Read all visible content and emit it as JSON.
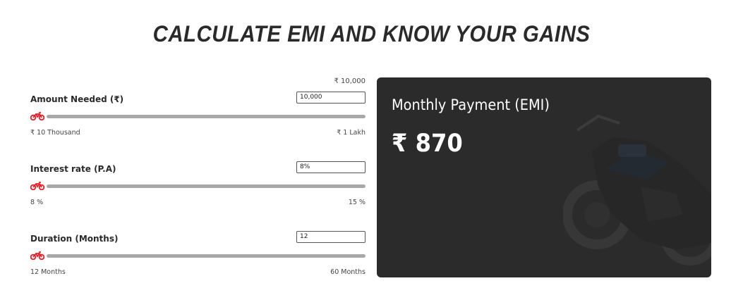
{
  "page": {
    "title": "CALCULATE EMI AND KNOW YOUR GAINS"
  },
  "calculator": {
    "amount": {
      "current_display": "₹ 10,000",
      "label": "Amount Needed (₹)",
      "input_value": "10,000",
      "min_label": "₹ 10 Thousand",
      "max_label": "₹ 1 Lakh",
      "slider_fraction": 0
    },
    "interest": {
      "label": "Interest rate (P.A)",
      "input_value": "8%",
      "min_label": "8 %",
      "max_label": "15 %",
      "slider_fraction": 0
    },
    "duration": {
      "label": "Duration (Months)",
      "input_value": "12",
      "min_label": "12 Months",
      "max_label": "60 Months",
      "slider_fraction": 0
    }
  },
  "emi": {
    "heading": "Monthly Payment (EMI)",
    "value": "₹ 870"
  },
  "colors": {
    "accent": "#e41e26",
    "card_bg": "#2b2b2b",
    "track": "#a8a8a8"
  },
  "icons": {
    "slider_thumb": "motorcycle-icon",
    "card_image": "motorcycle-image"
  }
}
